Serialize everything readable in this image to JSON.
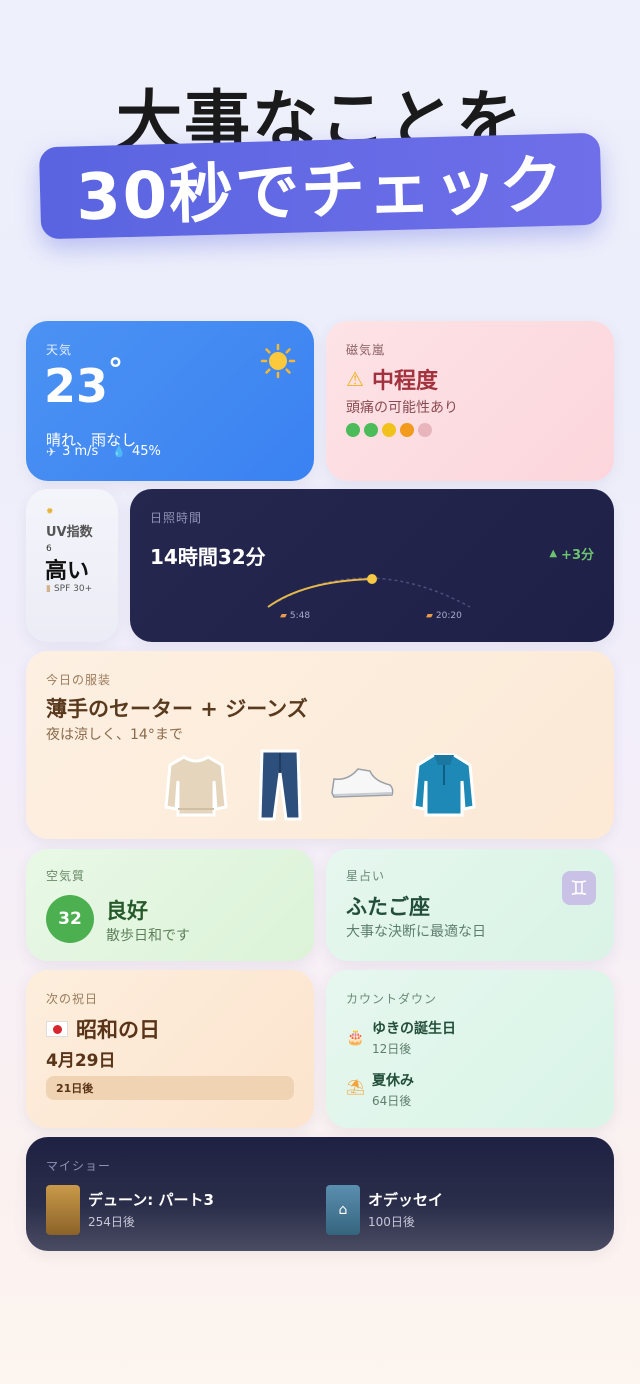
{
  "header": {
    "title": "大事なことを",
    "badge": "30秒でチェック"
  },
  "weather": {
    "label": "天気",
    "temp": "23",
    "degree": "°",
    "condition": "晴れ、雨なし",
    "wind": "3 m/s",
    "humidity": "45%",
    "icon": "sun-icon"
  },
  "magnetic": {
    "label": "磁気嵐",
    "level": "中程度",
    "note": "頭痛の可能性あり",
    "dot_colors": [
      "#4cbb5a",
      "#4cbb5a",
      "#f1c21b",
      "#f29a1c",
      "#e9b5bd"
    ]
  },
  "uv": {
    "label": "UV指数",
    "value": "6",
    "level": "高い",
    "advice": "SPF 30+"
  },
  "daylight": {
    "label": "日照時間",
    "duration": "14時間32分",
    "change": "+3分",
    "sunrise": "5:48",
    "sunset": "20:20"
  },
  "outfit": {
    "label": "今日の服装",
    "title": "薄手のセーター + ジーンズ",
    "note": "夜は涼しく、14°まで",
    "items": [
      "sweater-icon",
      "jeans-icon",
      "sneaker-icon",
      "jacket-icon"
    ]
  },
  "air": {
    "label": "空気質",
    "value": "32",
    "status": "良好",
    "note": "散歩日和です"
  },
  "horoscope": {
    "label": "星占い",
    "sign": "ふたご座",
    "note": "大事な決断に最適な日",
    "symbol": "♊"
  },
  "holiday": {
    "label": "次の祝日",
    "name": "昭和の日",
    "date": "4月29日",
    "days": "21日後"
  },
  "countdown": {
    "label": "カウントダウン",
    "items": [
      {
        "name": "ゆきの誕生日",
        "days": "12日後",
        "icon": "cake-icon"
      },
      {
        "name": "夏休み",
        "days": "64日後",
        "icon": "beach-icon"
      }
    ]
  },
  "shows": {
    "label": "マイショー",
    "items": [
      {
        "title": "デューン: パート3",
        "days": "254日後"
      },
      {
        "title": "オデッセイ",
        "days": "100日後"
      }
    ]
  },
  "colors": {
    "accent": "#5a64e0",
    "weather_bg": "#4289f3",
    "night_bg": "#22244c"
  }
}
